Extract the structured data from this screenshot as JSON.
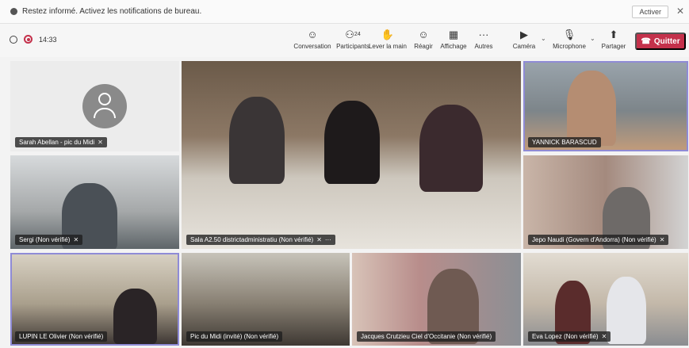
{
  "notification": {
    "message": "Restez informé. Activez les notifications de bureau.",
    "activate_label": "Activer",
    "close_glyph": "✕"
  },
  "toolbar": {
    "timer": "14:33",
    "buttons": [
      {
        "label": "Conversation",
        "icon": "chat-icon",
        "glyph": "☺"
      },
      {
        "label": "Participants",
        "icon": "people-icon",
        "glyph": "⚇",
        "count": "24"
      },
      {
        "label": "Lever la main",
        "icon": "raise-hand-icon",
        "glyph": "✋"
      },
      {
        "label": "Réagir",
        "icon": "react-icon",
        "glyph": "☺"
      },
      {
        "label": "Affichage",
        "icon": "view-icon",
        "glyph": "▦"
      },
      {
        "label": "Autres",
        "icon": "more-icon",
        "glyph": "···"
      },
      {
        "label": "Caméra",
        "icon": "camera-icon",
        "glyph": "▶"
      },
      {
        "label": "Microphone",
        "icon": "microphone-icon",
        "glyph": "🎙"
      },
      {
        "label": "Partager",
        "icon": "share-icon",
        "glyph": "⬆"
      }
    ],
    "quit_label": "Quitter"
  },
  "tiles": [
    {
      "name": "Sarah Abellan - pic du Midi"
    },
    {
      "name": "Sala A2.50 districtadministratiu (Non vérifié)"
    },
    {
      "name": "YANNICK BARASCUD"
    },
    {
      "name": "Sergi (Non vérifié)"
    },
    {
      "name": "Jepo Naudi (Govern d'Andorra) (Non vérifié)"
    },
    {
      "name": "LUPIN LE Olivier (Non vérifié)"
    },
    {
      "name": "Pic du Midi (invité) (Non vérifié)"
    },
    {
      "name": "Jacques Crutzieu Ciel d'Occitanie (Non vérifié)"
    },
    {
      "name": "Eva Lopez (Non vérifié)"
    }
  ],
  "colors": {
    "accent": "#8f8bd6",
    "quit": "#c4314b"
  }
}
